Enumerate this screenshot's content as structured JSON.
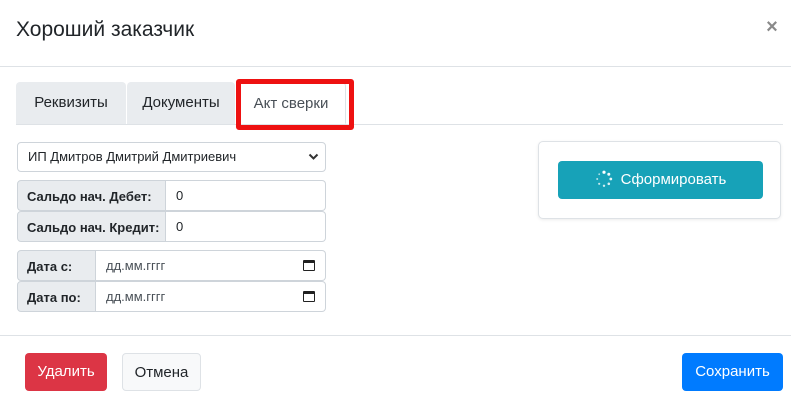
{
  "modal": {
    "title": "Хороший заказчик",
    "close_label": "×"
  },
  "tabs": [
    {
      "label": "Реквизиты"
    },
    {
      "label": "Документы"
    },
    {
      "label": "Акт сверки",
      "active": true
    }
  ],
  "form": {
    "select": {
      "value": "ИП Дмитров Дмитрий Дмитриевич"
    },
    "debit": {
      "label": "Сальдо нач. Дебет:",
      "value": "0"
    },
    "credit": {
      "label": "Сальдо нач. Кредит:",
      "value": "0"
    },
    "date_from": {
      "label": "Дата с:",
      "placeholder": "дд.мм.гггг"
    },
    "date_to": {
      "label": "Дата по:",
      "placeholder": "дд.мм.гггг"
    }
  },
  "generate_button": {
    "label": "Сформировать",
    "icon": "spinner-icon"
  },
  "footer": {
    "delete_label": "Удалить",
    "cancel_label": "Отмена",
    "save_label": "Сохранить"
  },
  "colors": {
    "highlight": "#ee1111",
    "info": "#17a2b8",
    "danger": "#dc3545",
    "primary": "#007bff"
  }
}
